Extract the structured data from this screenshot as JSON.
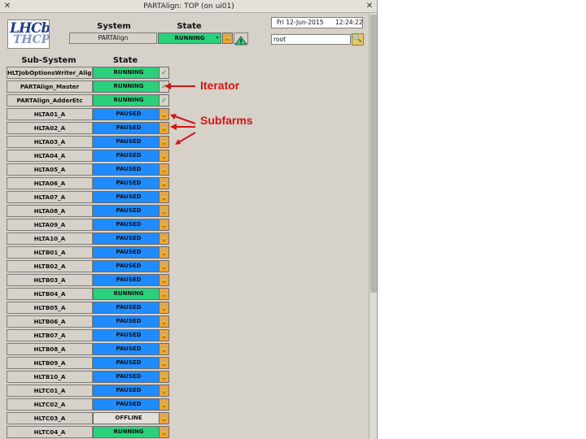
{
  "window": {
    "title": "PARTAlign: TOP (on ui01)"
  },
  "header": {
    "system_label": "System",
    "state_label": "State",
    "system_value": "PARTAlign",
    "system_state": "RUNNING",
    "date": "Fri 12-Jun-2015",
    "time": "12:24:22",
    "user": "root"
  },
  "table": {
    "col_subsystem": "Sub-System",
    "col_state": "State",
    "rows": [
      {
        "name": "HLTJobOptionsWriter_Align",
        "state": "RUNNING",
        "icon": "check-icon"
      },
      {
        "name": "PARTAlign_Master",
        "state": "RUNNING",
        "icon": "check-icon"
      },
      {
        "name": "PARTAlign_AdderEtc",
        "state": "RUNNING",
        "icon": "check-icon"
      },
      {
        "name": "HLTA01_A",
        "state": "PAUSED",
        "icon": "lock-icon"
      },
      {
        "name": "HLTA02_A",
        "state": "PAUSED",
        "icon": "lock-icon"
      },
      {
        "name": "HLTA03_A",
        "state": "PAUSED",
        "icon": "lock-icon"
      },
      {
        "name": "HLTA04_A",
        "state": "PAUSED",
        "icon": "lock-icon"
      },
      {
        "name": "HLTA05_A",
        "state": "PAUSED",
        "icon": "lock-icon"
      },
      {
        "name": "HLTA06_A",
        "state": "PAUSED",
        "icon": "lock-icon"
      },
      {
        "name": "HLTA07_A",
        "state": "PAUSED",
        "icon": "lock-icon"
      },
      {
        "name": "HLTA08_A",
        "state": "PAUSED",
        "icon": "lock-icon"
      },
      {
        "name": "HLTA09_A",
        "state": "PAUSED",
        "icon": "lock-icon"
      },
      {
        "name": "HLTA10_A",
        "state": "PAUSED",
        "icon": "lock-icon"
      },
      {
        "name": "HLTB01_A",
        "state": "PAUSED",
        "icon": "lock-icon"
      },
      {
        "name": "HLTB02_A",
        "state": "PAUSED",
        "icon": "lock-icon"
      },
      {
        "name": "HLTB03_A",
        "state": "PAUSED",
        "icon": "lock-icon"
      },
      {
        "name": "HLTB04_A",
        "state": "RUNNING",
        "icon": "lock-icon"
      },
      {
        "name": "HLTB05_A",
        "state": "PAUSED",
        "icon": "lock-icon"
      },
      {
        "name": "HLTB06_A",
        "state": "PAUSED",
        "icon": "lock-icon"
      },
      {
        "name": "HLTB07_A",
        "state": "PAUSED",
        "icon": "lock-icon"
      },
      {
        "name": "HLTB08_A",
        "state": "PAUSED",
        "icon": "lock-icon"
      },
      {
        "name": "HLTB09_A",
        "state": "PAUSED",
        "icon": "lock-icon"
      },
      {
        "name": "HLTB10_A",
        "state": "PAUSED",
        "icon": "lock-icon"
      },
      {
        "name": "HLTC01_A",
        "state": "PAUSED",
        "icon": "lock-icon"
      },
      {
        "name": "HLTC02_A",
        "state": "PAUSED",
        "icon": "lock-icon"
      },
      {
        "name": "HLTC03_A",
        "state": "OFFLINE",
        "icon": "unlocked-icon"
      },
      {
        "name": "HLTC04_A",
        "state": "RUNNING",
        "icon": "lock-icon"
      },
      {
        "name": "",
        "state": "",
        "icon": "lock-icon"
      }
    ]
  },
  "annotations": {
    "iterator": "Iterator",
    "subfarms": "Subfarms"
  },
  "colors": {
    "running": "#2bd07a",
    "paused": "#1e8bff",
    "offline": "#e3e0d9",
    "annotation": "#d41414"
  }
}
